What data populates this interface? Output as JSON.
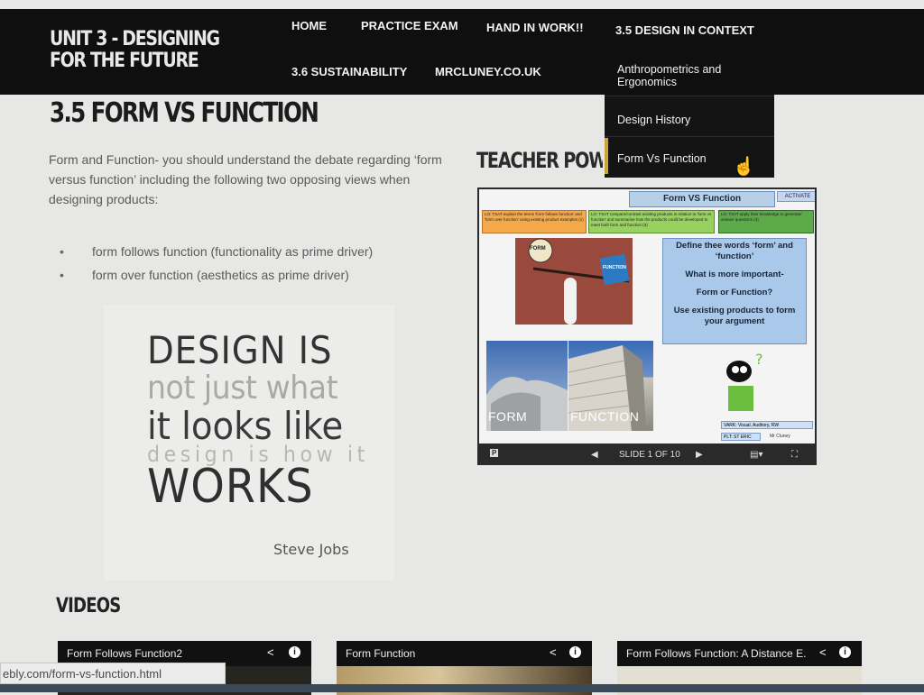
{
  "site": {
    "logo": "UNIT 3 - DESIGNING FOR THE FUTURE"
  },
  "nav": {
    "items": [
      "HOME",
      "PRACTICE EXAM",
      "HAND IN WORK!!",
      "3.5 DESIGN IN CONTEXT",
      "3.6 SUSTAINABILITY",
      "MRCLUNEY.CO.UK"
    ],
    "dropdown": [
      "Anthropometrics and Ergonomics",
      "Design History",
      "Form Vs Function"
    ]
  },
  "main": {
    "title": "3.5 FORM VS FUNCTION",
    "intro": "Form and Function- you should understand the debate regarding ‘form versus function’ including the following two opposing views when designing products:",
    "bullets": [
      "form follows function (functionality as prime driver)",
      "form over function (aesthetics as prime driver)"
    ],
    "quote": {
      "line1": "DESIGN IS",
      "line2": "not just what",
      "line3": "it looks like",
      "line4": "design is how it",
      "line5": "WORKS",
      "author": "Steve Jobs"
    }
  },
  "teacher": {
    "heading": "TEACHER POWER",
    "slide": {
      "title": "Form VS Function",
      "activate": "ACTIVATE",
      "objectives": [
        "LO: TSAT explain the terms 'form follows function' and 'form over function' using existing product examples (1)",
        "LO: TSAT compare/contrast existing products in relation to 'form vs function' and summarise how the products could be developed to meet both form and function (3)",
        "LO: TSAT apply their knowledge to generate/ answer questions (3)"
      ],
      "cartoon_form": "FORM",
      "cartoon_function": "FUNCTION",
      "questions": [
        "Define thee words ‘form’ and ‘function’",
        "What is more important-",
        "Form or Function?",
        "Use existing products to form your argument"
      ],
      "photo1_label": "FORM",
      "photo2_label": "FUNCTION",
      "vark": "VARK: Visual, Auditory, RW",
      "plt": "PLT: ST ERIC",
      "author": "Mr Cluney"
    },
    "slide_counter": "SLIDE 1 OF 10"
  },
  "videos": {
    "heading": "VIDEOS",
    "items": [
      "Form Follows Function2",
      "Form Function",
      "Form Follows Function: A Distance E..."
    ]
  },
  "status_url": "ebly.com/form-vs-function.html",
  "colors": {
    "header_bg": "#0f0f0f",
    "page_bg": "#e7e8e5",
    "accent": "#c9a43a",
    "slide_blue": "#a9c8ea"
  }
}
